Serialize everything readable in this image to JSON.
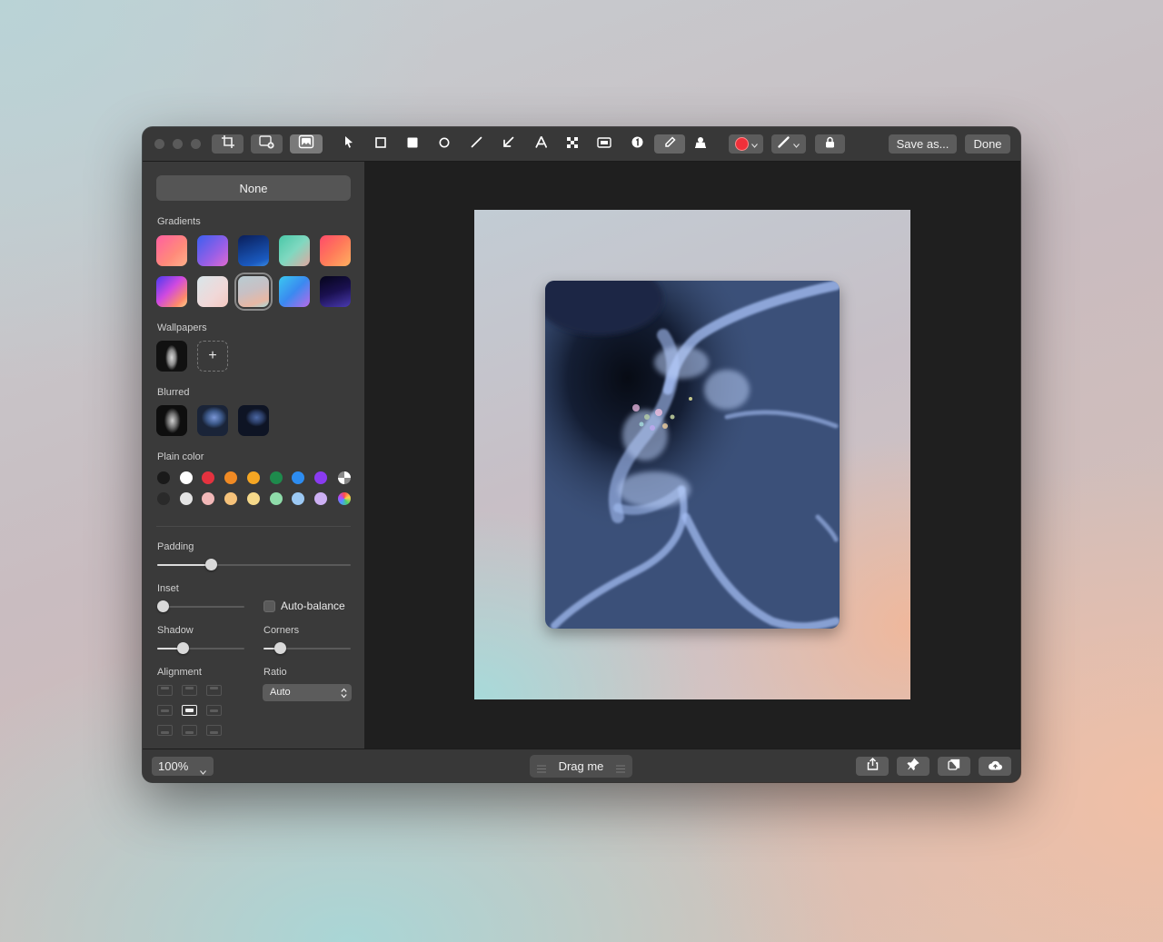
{
  "sidebar": {
    "none_label": "None",
    "gradients_label": "Gradients",
    "wallpapers_label": "Wallpapers",
    "add_wallpaper": "+",
    "blurred_label": "Blurred",
    "plain_color_label": "Plain color",
    "padding_label": "Padding",
    "inset_label": "Inset",
    "auto_balance_label": "Auto-balance",
    "shadow_label": "Shadow",
    "corners_label": "Corners",
    "alignment_label": "Alignment",
    "ratio_label": "Ratio",
    "ratio_value": "Auto",
    "padding_level": 0.28,
    "inset_level": 0.0,
    "shadow_level": 0.3,
    "corners_level": 0.19,
    "auto_balance_checked": false,
    "alignment_selected": "center"
  },
  "toolbar": {
    "save_as_label": "Save as...",
    "done_label": "Done",
    "active_tool": "highlighter-icon",
    "stroke_color": "#f0303a"
  },
  "bottombar": {
    "zoom_value": "100%",
    "drag_label": "Drag me"
  },
  "colors": {
    "plain_row1": [
      "#1a1a1a",
      "#ffffff",
      "#e5323f",
      "#f08a24",
      "#f5a623",
      "#1e8a4c",
      "#2d8cf0",
      "#8a3bf0"
    ],
    "plain_row2": [
      "#2a2a2a",
      "#e4e4e4",
      "#f2b8b8",
      "#f6c27a",
      "#f6d98a",
      "#8fdcaa",
      "#9cc9f4",
      "#cdb0f4"
    ]
  }
}
